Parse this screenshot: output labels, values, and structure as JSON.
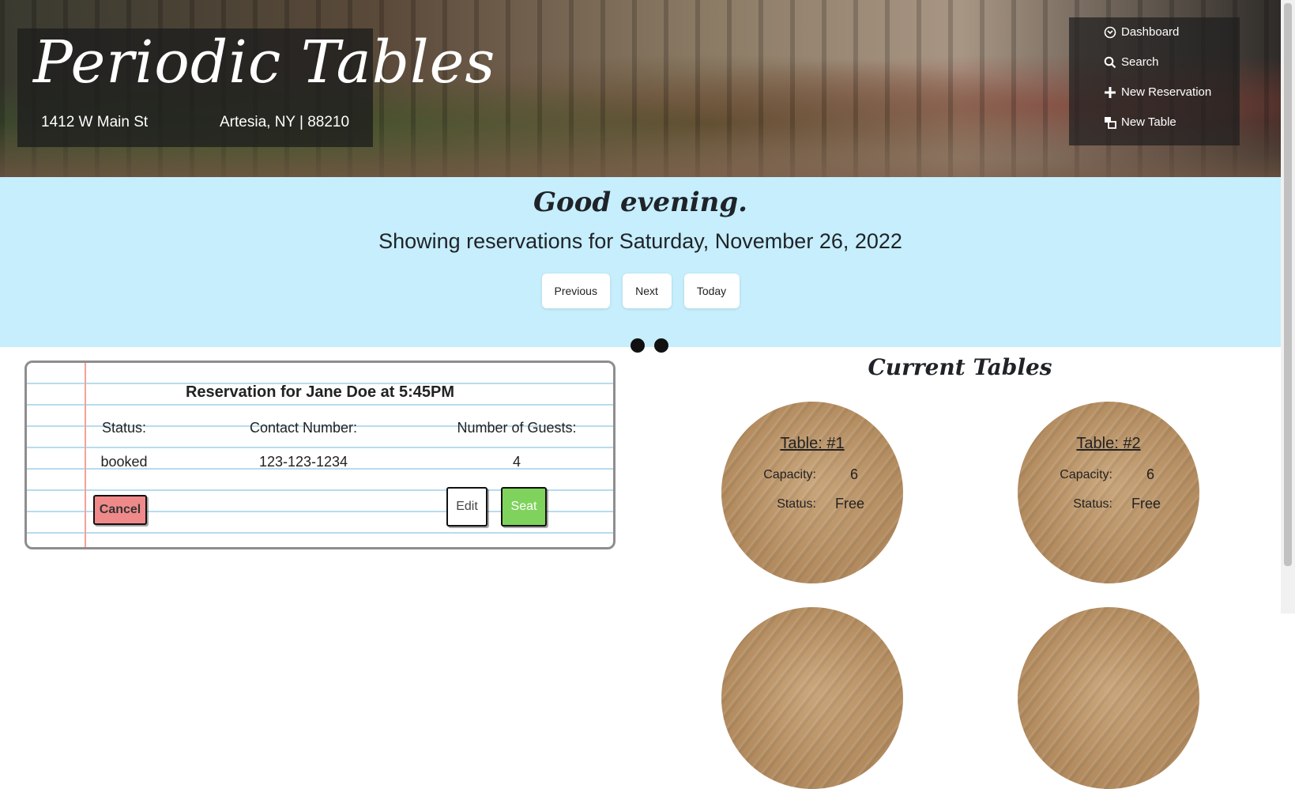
{
  "header": {
    "brand_title": "Periodic Tables",
    "address": "1412 W Main St",
    "city": "Artesia, NY | 88210"
  },
  "nav": {
    "items": [
      {
        "label": "Dashboard",
        "icon": "dashboard-icon"
      },
      {
        "label": "Search",
        "icon": "search-icon"
      },
      {
        "label": "New Reservation",
        "icon": "plus-icon"
      },
      {
        "label": "New Table",
        "icon": "new-table-icon"
      }
    ]
  },
  "dashboard": {
    "greeting": "Good evening.",
    "showing": "Showing reservations for Saturday, November 26, 2022",
    "buttons": {
      "previous": "Previous",
      "next": "Next",
      "today": "Today"
    }
  },
  "reservation": {
    "title": "Reservation for Jane Doe at 5:45PM",
    "status_label": "Status:",
    "contact_label": "Contact Number:",
    "guests_label": "Number of Guests:",
    "status": "booked",
    "contact": "123-123-1234",
    "guests": "4",
    "cancel_label": "Cancel",
    "edit_label": "Edit",
    "seat_label": "Seat"
  },
  "tables_section": {
    "title": "Current Tables",
    "tables": [
      {
        "name": "Table: #1",
        "capacity_label": "Capacity:",
        "capacity": "6",
        "status_label": "Status:",
        "status": "Free"
      },
      {
        "name": "Table: #2",
        "capacity_label": "Capacity:",
        "capacity": "6",
        "status_label": "Status:",
        "status": "Free"
      }
    ]
  },
  "colors": {
    "band": "#c6eefc",
    "cancel": "#f08a8a",
    "seat": "#7fd35c",
    "table_wood": "#b48d61"
  }
}
